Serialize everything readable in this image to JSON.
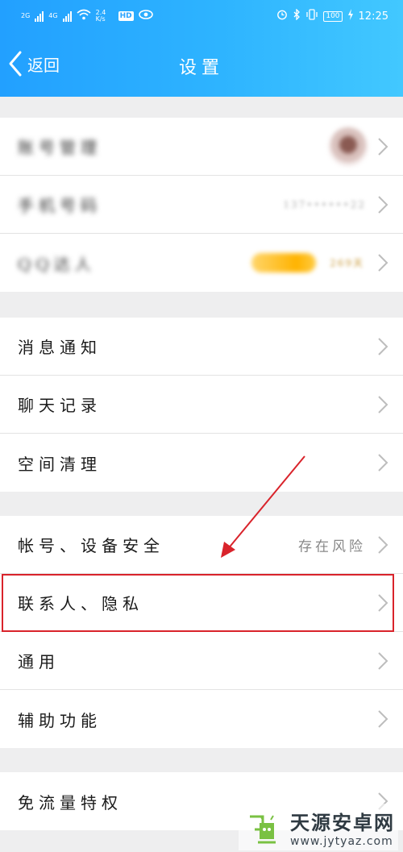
{
  "statusbar": {
    "net1": "2G",
    "net2": "4G",
    "speed": "2.4 K/s",
    "hd": "HD",
    "battery": "100",
    "time": "12:25"
  },
  "header": {
    "back_label": "返回",
    "title": "设置"
  },
  "account_group": [
    {
      "label": "账号管理"
    },
    {
      "label": "手机号码",
      "value": "137••••••22"
    },
    {
      "label": "QQ达人",
      "value": "269天"
    }
  ],
  "group2": [
    {
      "label": "消息通知"
    },
    {
      "label": "聊天记录"
    },
    {
      "label": "空间清理"
    }
  ],
  "group3": [
    {
      "label": "帐号、设备安全",
      "value": "存在风险"
    },
    {
      "label": "联系人、隐私"
    },
    {
      "label": "通用"
    },
    {
      "label": "辅助功能"
    }
  ],
  "group4": [
    {
      "label": "免流量特权"
    }
  ],
  "watermark": {
    "name": "天源安卓网",
    "url": "www.jytyaz.com"
  },
  "colors": {
    "header_start": "#22a0ff",
    "header_end": "#42c8ff",
    "highlight": "#d9232b",
    "arrow": "#d9232b"
  }
}
